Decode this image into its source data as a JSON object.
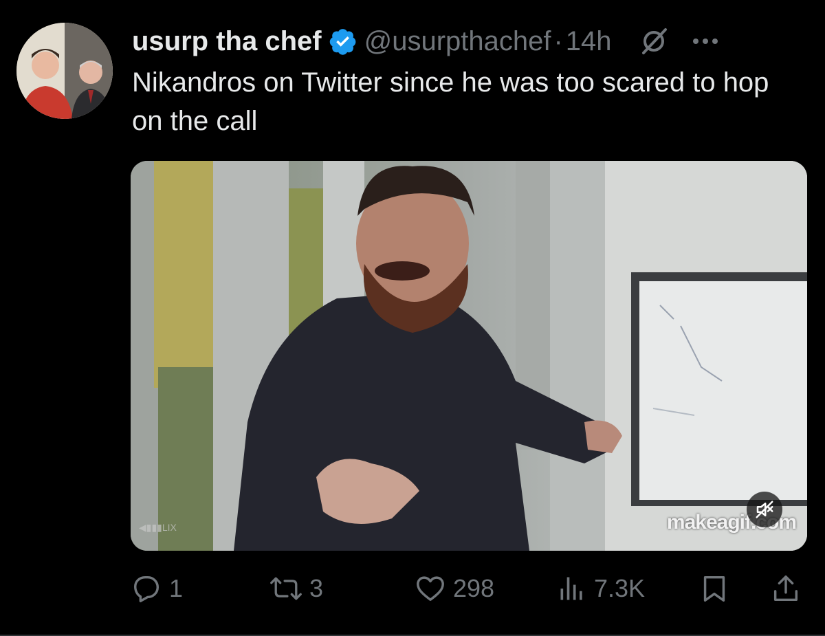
{
  "author": {
    "display_name": "usurp tha chef",
    "handle": "@usurpthachef",
    "separator": "·",
    "time": "14h",
    "verified": true
  },
  "tweet": {
    "text": "Nikandros on Twitter since he was too scared to hop on the call"
  },
  "media": {
    "type": "video",
    "watermark": "makeagif.com",
    "muted": true
  },
  "actions": {
    "replies": "1",
    "reposts": "3",
    "likes": "298",
    "views": "7.3K"
  },
  "icons": {
    "verified": "verified-badge-icon",
    "grok": "grok-icon",
    "more": "more-icon",
    "reply": "reply-icon",
    "repost": "repost-icon",
    "like": "heart-icon",
    "views": "views-icon",
    "bookmark": "bookmark-icon",
    "share": "share-icon",
    "mute": "mute-icon"
  },
  "colors": {
    "background": "#000000",
    "text_primary": "#e7e9ea",
    "text_secondary": "#71767b",
    "verified_blue": "#1d9bf0"
  }
}
